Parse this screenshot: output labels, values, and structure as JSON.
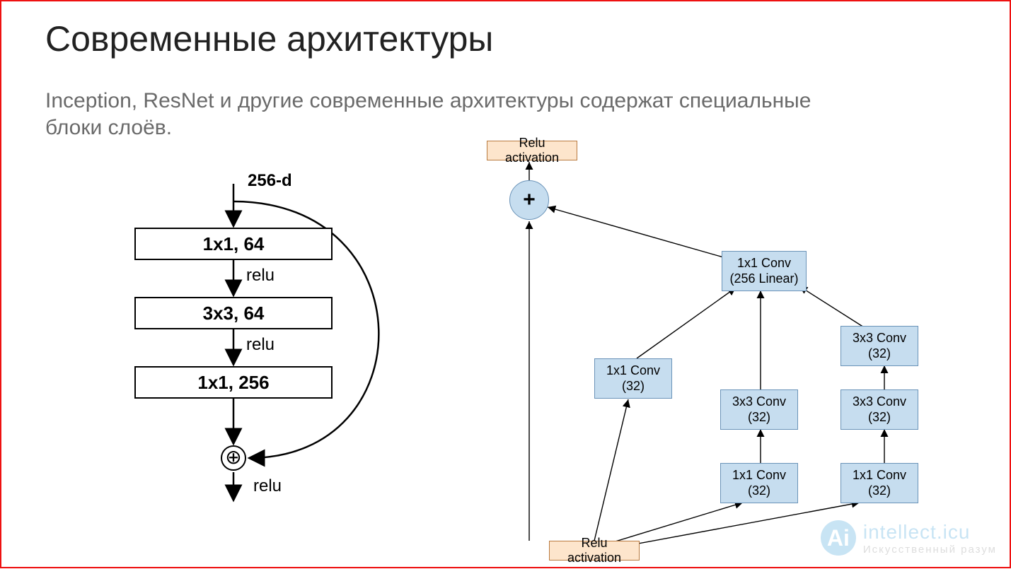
{
  "title": "Современные архитектуры",
  "subtitle": "Inception, ResNet и другие современные архитектуры содержат специальные блоки слоёв.",
  "left": {
    "input": "256-d",
    "box1": "1x1, 64",
    "relu1": "relu",
    "box2": "3x3, 64",
    "relu2": "relu",
    "box3": "1x1, 256",
    "plus": "+",
    "relu3": "relu"
  },
  "right": {
    "relu_top": "Relu activation",
    "plus": "+",
    "conv_merge_l1": "1x1 Conv",
    "conv_merge_l2": "(256 Linear)",
    "branch1_l1": "1x1 Conv",
    "branch1_l2": "(32)",
    "branch2a_l1": "3x3 Conv",
    "branch2a_l2": "(32)",
    "branch2b_l1": "1x1 Conv",
    "branch2b_l2": "(32)",
    "branch3a_l1": "3x3 Conv",
    "branch3a_l2": "(32)",
    "branch3b_l1": "3x3 Conv",
    "branch3b_l2": "(32)",
    "branch3c_l1": "1x1 Conv",
    "branch3c_l2": "(32)",
    "relu_bottom": "Relu activation"
  },
  "watermark": {
    "logo": "Ai",
    "line1": "intellect.icu",
    "line2": "Искусственный разум"
  }
}
